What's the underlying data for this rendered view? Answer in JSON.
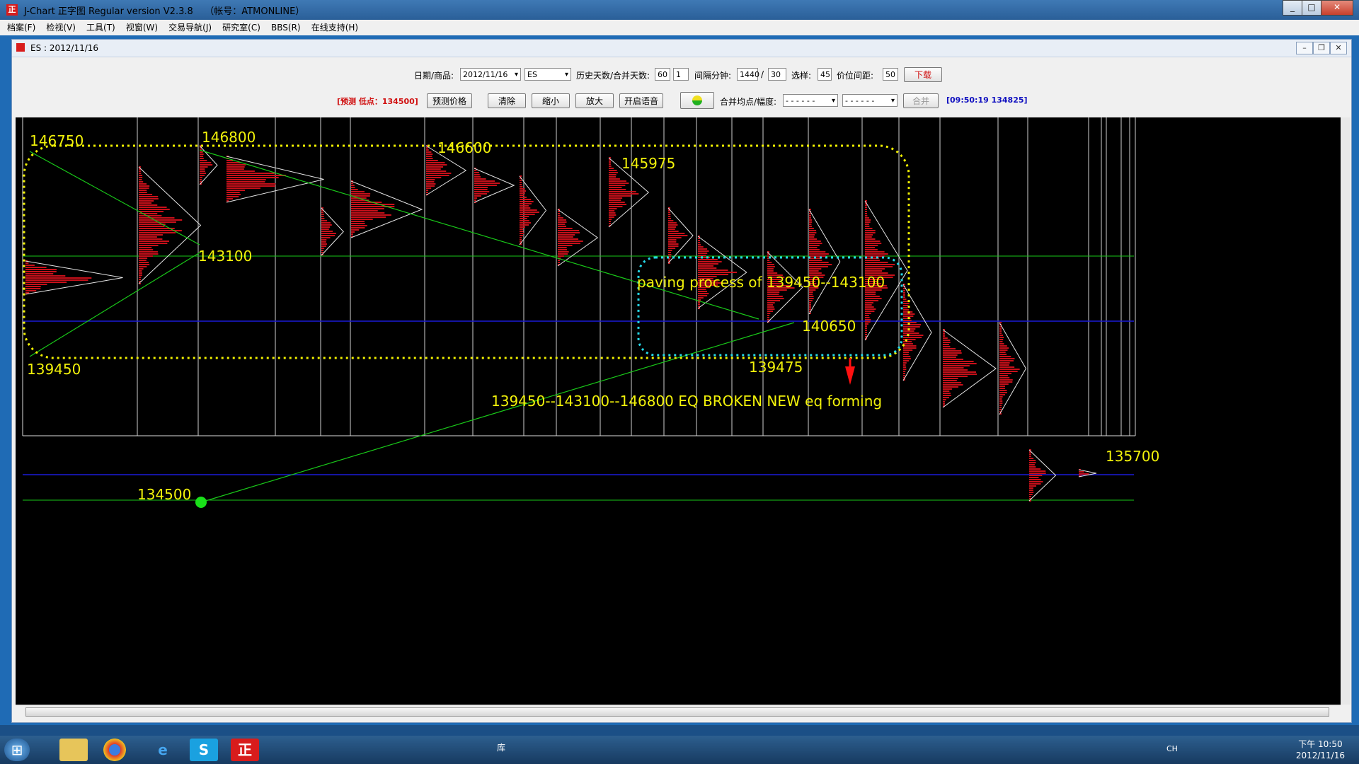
{
  "window": {
    "title": "J-Chart 正字图 Regular version V2.3.8",
    "account": "（帐号：ATMONLINE）",
    "icon_label": "正"
  },
  "menu": [
    "档案(F)",
    "检视(V)",
    "工具(T)",
    "视窗(W)",
    "交易导航(J)",
    "研究室(C)",
    "BBS(R)",
    "在线支持(H)"
  ],
  "child": {
    "title": "ES : 2012/11/16"
  },
  "toolbar": {
    "date_label": "日期/商品:",
    "date_value": "2012/11/16",
    "symbol_value": "ES",
    "history_label": "历史天数/合并天数:",
    "history_days": "60",
    "merge_days": "1",
    "interval_label": "间隔分钟:",
    "interval_value": "1440",
    "slash": "/",
    "interval_value2": "30",
    "select_label": "选样:",
    "select_value": "45",
    "price_gap_label": "价位间距:",
    "price_gap_value": "50",
    "download_label": "下载",
    "forecast_text": "[预测 低点：134500]",
    "forecast_button": "预测价格",
    "clear_button": "清除",
    "zoom_out_button": "缩小",
    "zoom_in_button": "放大",
    "voice_button": "开启语音",
    "merge_avg_label": "合并均点/幅度:",
    "merge_combo1": "- - - - - -",
    "merge_combo2": "- - - - - -",
    "merge_button": "合并",
    "status_text": "[09:50:19 134825]"
  },
  "chart_annotations": {
    "p146750": "146750",
    "p146800": "146800",
    "p146600": "146600",
    "p145975": "145975",
    "p143100": "143100",
    "p139450": "139450",
    "p140650": "140650",
    "p139475": "139475",
    "p134500": "134500",
    "p135700": "135700",
    "paving": "paving process  of 139450--143100",
    "eq_note": "139450--143100--146800 EQ BROKEN NEW eq forming"
  },
  "colors": {
    "chart_bg": "#000000",
    "profile": "#c8101a",
    "annotation_text": "#f2f20a",
    "trend_line": "#19c819",
    "level_line_blue": "#1a1ad8",
    "dotted_yellow": "#f0f000",
    "dotted_cyan": "#25d8e8",
    "red_arrow": "#ff1010"
  },
  "taskbar": {
    "ime": "CH",
    "clock_period": "下午 10:50",
    "clock_date": "2012/11/16",
    "library_label": "库"
  }
}
